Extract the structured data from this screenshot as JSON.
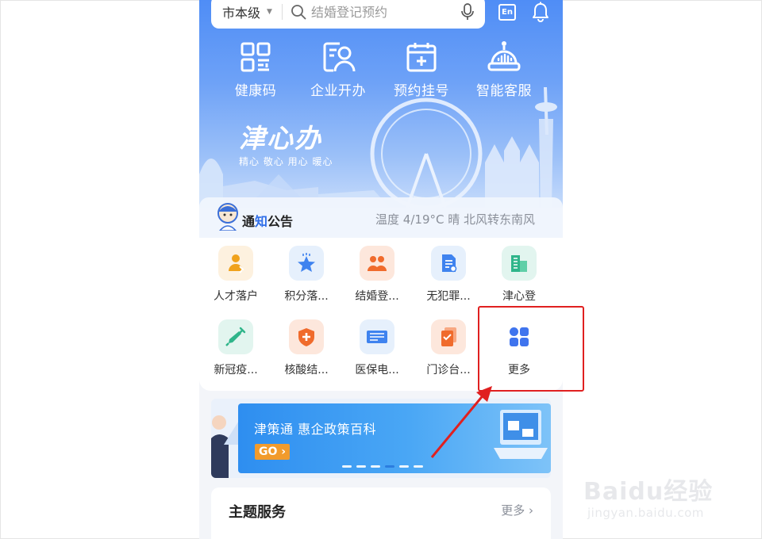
{
  "search": {
    "region": "市本级",
    "placeholder": "结婚登记预约"
  },
  "header": {
    "lang_label": "En"
  },
  "quick_actions": [
    {
      "label": "健康码",
      "icon": "qr-code-icon"
    },
    {
      "label": "企业开办",
      "icon": "business-card-icon"
    },
    {
      "label": "预约挂号",
      "icon": "calendar-plus-icon"
    },
    {
      "label": "智能客服",
      "icon": "robot-icon"
    }
  ],
  "brand": {
    "name": "津心办",
    "tagline": "精心 敬心 用心 暖心"
  },
  "notice": {
    "title_part1": "通",
    "title_part2": "知",
    "title_part3": "公告",
    "weather": "温度 4/19°C 晴 北风转东南风"
  },
  "services": [
    {
      "label": "人才落户",
      "icon": "talent-settlement-icon",
      "bg": "#fdf1df",
      "fg": "#f0a21c"
    },
    {
      "label": "积分落...",
      "icon": "star-points-icon",
      "bg": "#e6f0fc",
      "fg": "#3f83ef"
    },
    {
      "label": "结婚登...",
      "icon": "couple-icon",
      "bg": "#fde7dc",
      "fg": "#f06b2c"
    },
    {
      "label": "无犯罪...",
      "icon": "document-icon",
      "bg": "#e6f0fc",
      "fg": "#3f83ef"
    },
    {
      "label": "津心登",
      "icon": "building-icon",
      "bg": "#e2f5ef",
      "fg": "#2fb58a"
    },
    {
      "label": "新冠疫...",
      "icon": "syringe-icon",
      "bg": "#e2f5ef",
      "fg": "#2fb58a"
    },
    {
      "label": "核酸结...",
      "icon": "shield-plus-icon",
      "bg": "#fde7dc",
      "fg": "#f06b2c"
    },
    {
      "label": "医保电...",
      "icon": "chs-card-icon",
      "bg": "#e6f0fc",
      "fg": "#3f83ef"
    },
    {
      "label": "门诊台...",
      "icon": "clipboard-icon",
      "bg": "#fde7dc",
      "fg": "#f06b2c"
    },
    {
      "label": "更多",
      "icon": "more-grid-icon",
      "bg": "#ffffff",
      "fg": "#3f74ee"
    }
  ],
  "banner": {
    "title": "津策通 惠企政策百科",
    "go_label": "GO",
    "slide_count": 6,
    "active_slide": 4
  },
  "theme_section": {
    "title": "主题服务",
    "more_label": "更多"
  },
  "watermark": {
    "brand": "Baidu经验",
    "url": "jingyan.baidu.com"
  },
  "colors": {
    "accent": "#2f6ee8",
    "highlight": "#e02020",
    "go": "#f29b2c"
  }
}
